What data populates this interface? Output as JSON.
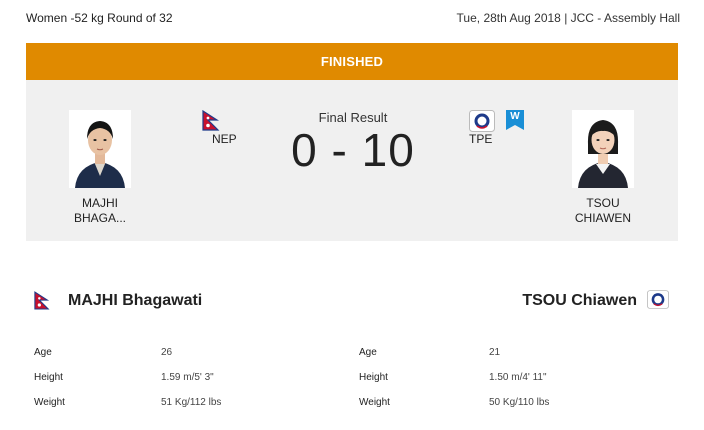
{
  "event": "Women -52 kg Round of 32",
  "date_venue": "Tue, 28th Aug 2018 | JCC - Assembly Hall",
  "status": "FINISHED",
  "result": {
    "label": "Final Result",
    "score": "0 - 10"
  },
  "athlete_left": {
    "name_line1": "MAJHI",
    "name_line2": "BHAGA...",
    "country": "NEP",
    "full_name": "MAJHI Bhagawati",
    "flag_color": "#c8102e",
    "stats": [
      {
        "label": "Age",
        "value": "26"
      },
      {
        "label": "Height",
        "value": "1.59 m/5' 3\""
      },
      {
        "label": "Weight",
        "value": "51 Kg/112 lbs"
      }
    ]
  },
  "athlete_right": {
    "name_line1": "TSOU",
    "name_line2": "CHIAWEN",
    "country": "TPE",
    "full_name": "TSOU Chiawen",
    "winner_badge": "W",
    "stats": [
      {
        "label": "Age",
        "value": "21"
      },
      {
        "label": "Height",
        "value": "1.50 m/4' 11\""
      },
      {
        "label": "Weight",
        "value": "50 Kg/110 lbs"
      }
    ]
  },
  "colors": {
    "status_bar": "#e08a00",
    "panel": "#f0f0f0",
    "winner_badge": "#1a8fd6"
  }
}
